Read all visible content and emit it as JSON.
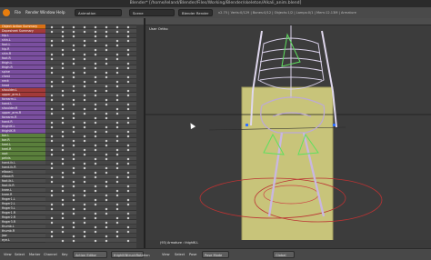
{
  "window": {
    "title": "Blender* [/home/leland/Blender/Files/Working/Blender/skeleton/Alkali_anim.blend]"
  },
  "menubar": {
    "items": [
      "File",
      "Render",
      "Window",
      "Help"
    ],
    "screen_field": "Animation",
    "scene_field": "Scene",
    "render_engine": "Blender Render",
    "info": "v2.75 | Verts:0/129 | Bones:0/12 | Objects:1/2 | Lamps:0/1 | Mem:12.13M | Armature"
  },
  "dopesheet": {
    "channels": [
      {
        "label": "Object Action Summary",
        "kind": "group"
      },
      {
        "label": "Dopesheet Summary",
        "kind": "action"
      },
      {
        "label": "hip.L",
        "kind": "purple"
      },
      {
        "label": "shin.L",
        "kind": "purple"
      },
      {
        "label": "foot.L",
        "kind": "purple"
      },
      {
        "label": "hip.R",
        "kind": "purple"
      },
      {
        "label": "shin.R",
        "kind": "purple"
      },
      {
        "label": "foot.R",
        "kind": "purple"
      },
      {
        "label": "thigh.L",
        "kind": "purple"
      },
      {
        "label": "thigh.R",
        "kind": "purple"
      },
      {
        "label": "spine",
        "kind": "purple"
      },
      {
        "label": "chest",
        "kind": "purple"
      },
      {
        "label": "neck",
        "kind": "purple"
      },
      {
        "label": "head",
        "kind": "purple"
      },
      {
        "label": "shoulder.L",
        "kind": "action"
      },
      {
        "label": "upper_arm.L",
        "kind": "action"
      },
      {
        "label": "forearm.L",
        "kind": "purple"
      },
      {
        "label": "hand.L",
        "kind": "purple"
      },
      {
        "label": "shoulder.R",
        "kind": "purple"
      },
      {
        "label": "upper_arm.R",
        "kind": "purple"
      },
      {
        "label": "forearm.R",
        "kind": "purple"
      },
      {
        "label": "hand.R",
        "kind": "purple"
      },
      {
        "label": "thighIK.L",
        "kind": "purple"
      },
      {
        "label": "thighIK.R",
        "kind": "purple"
      },
      {
        "label": "toe.L",
        "kind": "green"
      },
      {
        "label": "toe.R",
        "kind": "green"
      },
      {
        "label": "heel.L",
        "kind": "green"
      },
      {
        "label": "heel.R",
        "kind": "green"
      },
      {
        "label": "root",
        "kind": "green"
      },
      {
        "label": "pelvis",
        "kind": "green"
      },
      {
        "label": "hand.ik.L",
        "kind": "grey"
      },
      {
        "label": "hand.ik.R",
        "kind": "grey"
      },
      {
        "label": "elbow.L",
        "kind": "grey"
      },
      {
        "label": "elbow.R",
        "kind": "grey"
      },
      {
        "label": "foot.ik.L",
        "kind": "grey"
      },
      {
        "label": "foot.ik.R",
        "kind": "grey"
      },
      {
        "label": "knee.L",
        "kind": "grey"
      },
      {
        "label": "knee.R",
        "kind": "grey"
      },
      {
        "label": "finger1.L",
        "kind": "grey"
      },
      {
        "label": "finger2.L",
        "kind": "grey"
      },
      {
        "label": "finger3.L",
        "kind": "grey"
      },
      {
        "label": "finger1.R",
        "kind": "grey"
      },
      {
        "label": "finger2.R",
        "kind": "grey"
      },
      {
        "label": "finger3.R",
        "kind": "grey"
      },
      {
        "label": "thumb.L",
        "kind": "grey"
      },
      {
        "label": "thumb.R",
        "kind": "grey"
      },
      {
        "label": "jaw",
        "kind": "grey"
      },
      {
        "label": "eye.L",
        "kind": "grey"
      }
    ]
  },
  "viewport": {
    "view_label": "User Ortho",
    "status_text": "(93) Armature : thighIK.L",
    "bones_color": "#5fe05f",
    "plane_color": "#c8c47a"
  },
  "bottombar": {
    "view": "View",
    "select": "Select",
    "marker": "Marker",
    "channel": "Channel",
    "key": "Key",
    "mode": "Action Editor",
    "action_name": "thighIKNtruckRotation",
    "viewport_view": "View",
    "viewport_select": "Select",
    "viewport_pose": "Pose",
    "interaction_mode": "Pose Mode",
    "orientation": "Global"
  },
  "colors": {
    "accent": "#e87d0d",
    "action_red": "#a23a3a",
    "group_purple": "#7a4f9f"
  }
}
